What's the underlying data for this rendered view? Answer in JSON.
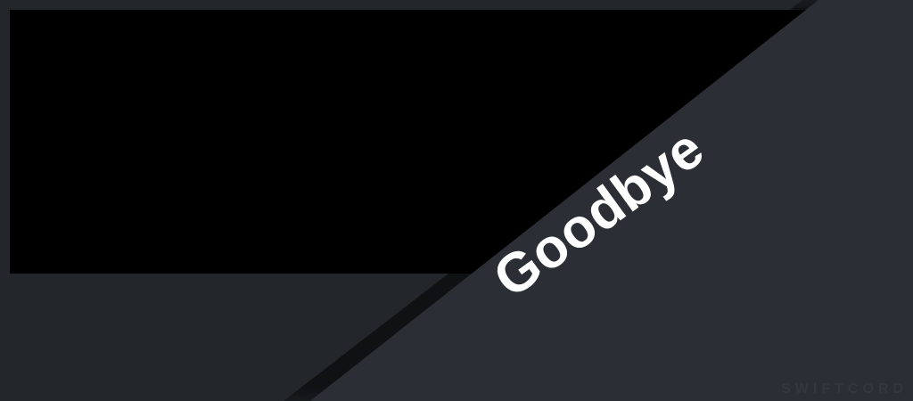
{
  "card": {
    "message": "Goodbye",
    "watermark": "SWIFTCORD"
  },
  "colors": {
    "background": "#23262b",
    "banner": "#000000",
    "diagonal_panel": "#2b2e34",
    "message_text": "#ffffff",
    "watermark_text": "#34373d"
  }
}
